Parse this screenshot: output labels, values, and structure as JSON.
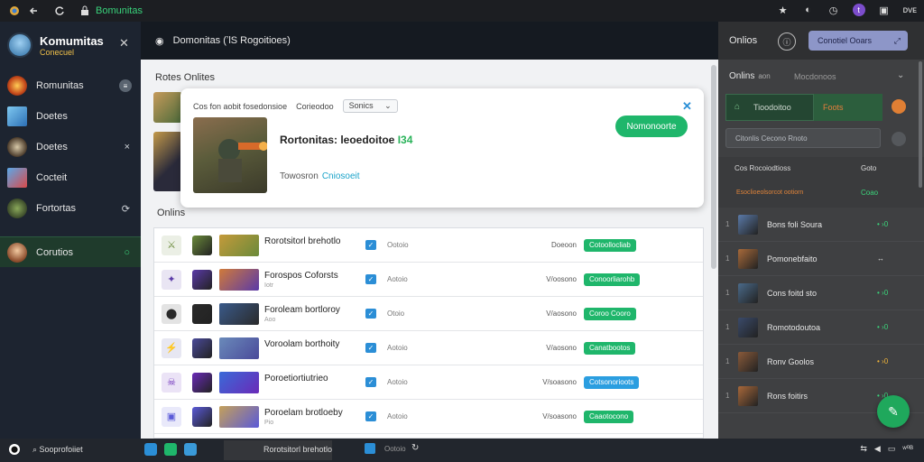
{
  "browser": {
    "url_text": "Bomunitas",
    "right_text": "ᴅᴠᴇ"
  },
  "sidebar": {
    "title": "Komumitas",
    "subtitle": "Conecuel",
    "items": [
      {
        "label": "Romunitas",
        "trail": "≡"
      },
      {
        "label": "Doetes",
        "trail": ""
      },
      {
        "label": "Doetes",
        "trail": "×"
      },
      {
        "label": "Cocteit",
        "trail": ""
      },
      {
        "label": "Fortortas",
        "trail": "⟳"
      },
      {
        "label": "Corutios",
        "trail": "○"
      }
    ]
  },
  "main": {
    "header": "Domonitas (ʼlS Rogoitioes)",
    "section_title": "Rotes Onlites",
    "online_label": "Onlins",
    "popup": {
      "filter1": "Cos fon aobit fosedonsioe",
      "filter2": "Corieodoo",
      "select": "Sonics",
      "game_name": "Rortonitas: leoedoitoe",
      "game_count": "Ɩ34",
      "meta_label": "Towosron",
      "meta_link": "Cniosoeit",
      "cta": "Nomonoorte",
      "close": "✕"
    },
    "rows": [
      {
        "name": "Rorotsitorl brehotlo",
        "sub": "",
        "state": "Ootoio",
        "when": "Doeoon",
        "action": "Cotoollocliab",
        "action_color": "#1fb66b"
      },
      {
        "name": "Forospos Coforsts",
        "sub": "Iotr",
        "state": "Aotoio",
        "when": "V/oosono",
        "action": "Conoorliarohb",
        "action_color": "#1fb66b"
      },
      {
        "name": "Foroleam bortloroy",
        "sub": "Aoo",
        "state": "Otoio",
        "when": "V/aosono",
        "action": "Coroo Cooro",
        "action_color": "#1fb66b"
      },
      {
        "name": "Voroolam borthoity",
        "sub": "",
        "state": "Aotoio",
        "when": "V/aosono",
        "action": "Canatbootos",
        "action_color": "#1fb66b"
      },
      {
        "name": "Poroetiortiutrieo",
        "sub": "",
        "state": "Aotoio",
        "when": "V/soasono",
        "action": "Cotsonorioots",
        "action_color": "#2b9ee0"
      },
      {
        "name": "Poroelam brotloeby",
        "sub": "Pio",
        "state": "Aotoio",
        "when": "V/soasono",
        "action": "Caaotocono",
        "action_color": "#1fb66b"
      }
    ]
  },
  "right": {
    "title": "Onlios",
    "circle": "ⓘ",
    "button": "Conotiel Ooars",
    "online": "Onlins",
    "online_small": "aon",
    "online_mid": "Mocdonoos",
    "tab1": "Tioodoitoo",
    "tab2": "Foots",
    "search": "Citonlis Cecono Rnoto",
    "sec_left1": "Cos Rocoiodtioss",
    "sec_right1": "Goto",
    "sec_left2": "Esoclioeolsorcot ootiorn",
    "sec_right2": "Coao",
    "items": [
      {
        "idx": "1",
        "name": "Bons foli Soura",
        "status": "• ›0"
      },
      {
        "idx": "1",
        "name": "Pomonebfaito",
        "status": "↔"
      },
      {
        "idx": "1",
        "name": "Cons foitd sto",
        "status": "• ›0"
      },
      {
        "idx": "1",
        "name": "Romotodoutoa",
        "status": "• ›0"
      },
      {
        "idx": "1",
        "name": "Ronv Goolos",
        "status": "• ›0"
      },
      {
        "idx": "1",
        "name": "Rons foitirs",
        "status": "• ›0"
      }
    ]
  },
  "taskbar": {
    "search": "Sooprofoiiet",
    "time": "ʷ⁰ᴮ"
  },
  "colors": {
    "accent_green": "#1fb66b",
    "accent_blue": "#2b8ed6",
    "sidebar_bg": "#1d2430"
  }
}
